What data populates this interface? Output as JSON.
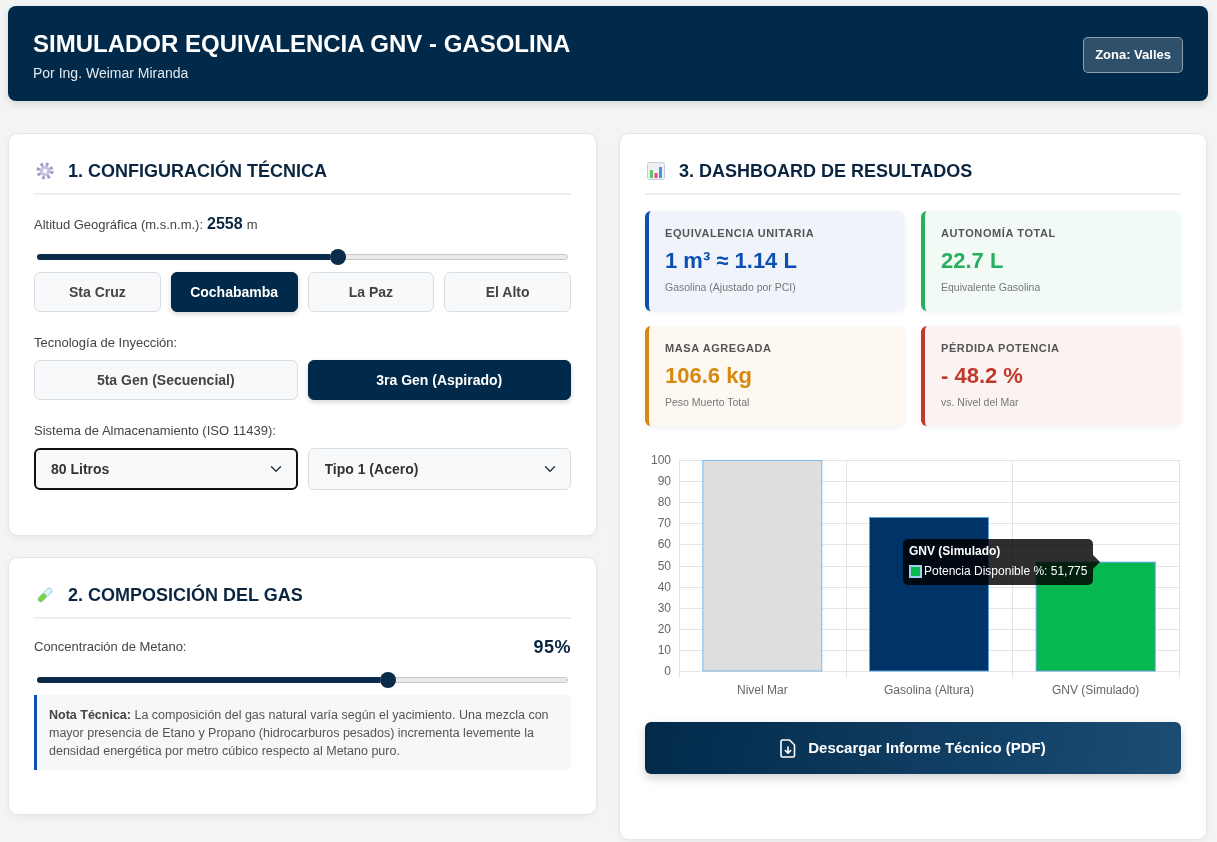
{
  "header": {
    "title": "SIMULADOR EQUIVALENCIA GNV - GASOLINA",
    "subtitle": "Por Ing. Weimar Miranda",
    "zone_badge": "Zona: Valles"
  },
  "config": {
    "title": "1. CONFIGURACIÓN TÉCNICA",
    "altitude": {
      "label": "Altitud Geográfica (m.s.n.m.):",
      "value": "2558",
      "unit": "m",
      "level": 0.567
    },
    "cities": [
      {
        "label": "Sta Cruz",
        "selected": false
      },
      {
        "label": "Cochabamba",
        "selected": true
      },
      {
        "label": "La Paz",
        "selected": false
      },
      {
        "label": "El Alto",
        "selected": false
      }
    ],
    "injection": {
      "label": "Tecnología de Inyección:",
      "options": [
        {
          "label": "5ta Gen (Secuencial)",
          "selected": false
        },
        {
          "label": "3ra Gen (Aspirado)",
          "selected": true
        }
      ]
    },
    "storage": {
      "label": "Sistema de Almacenamiento (ISO 11439):",
      "selects": [
        {
          "value": "80 Litros",
          "focused": true
        },
        {
          "value": "Tipo 1 (Acero)",
          "focused": false
        }
      ]
    }
  },
  "composition": {
    "title": "2. COMPOSICIÓN DEL GAS",
    "methane": {
      "label": "Concentración de Metano:",
      "value": "95%",
      "level": 0.662
    },
    "note": "**Nota Técnica:** La composición del gas natural varía según el yacimiento. Una mezcla con mayor presencia de Etano y Propano (hidrocarburos pesados) incrementa levemente la densidad energética por metro cúbico respecto al Metano puro."
  },
  "dashboard": {
    "title": "3. DASHBOARD DE RESULTADOS",
    "stats": [
      {
        "label": "EQUIVALENCIA UNITARIA",
        "value": "1 m³ ≈ 1.14 L",
        "caption": "Gasolina (Ajustado por PCI)",
        "color": "#0b4fb0"
      },
      {
        "label": "AUTONOMÍA TOTAL",
        "value": "22.7 L",
        "caption": "Equivalente Gasolina",
        "color": "#27ae60"
      },
      {
        "label": "MASA AGREGADA",
        "value": "106.6 kg",
        "caption": "Peso Muerto Total",
        "color": "#d68910"
      },
      {
        "label": "PÉRDIDA POTENCIA",
        "value": "- 48.2 %",
        "caption": "vs. Nivel del Mar",
        "color": "#c0392b"
      }
    ],
    "chart": {
      "chart_data": {
        "type": "bar",
        "categories": [
          "Nivel Mar",
          "Gasolina (Altura)",
          "GNV (Simulado)"
        ],
        "values": [
          100,
          73,
          51.8
        ],
        "ylim": [
          0,
          100
        ],
        "yticks": [
          0,
          10,
          20,
          30,
          40,
          50,
          60,
          70,
          80,
          90,
          100
        ],
        "grid": true
      },
      "tooltip": {
        "title": "GNV (Simulado)",
        "label": "Potencia Disponible %: 51,775"
      }
    },
    "download_button": "Descargar Informe Técnico (PDF)"
  }
}
